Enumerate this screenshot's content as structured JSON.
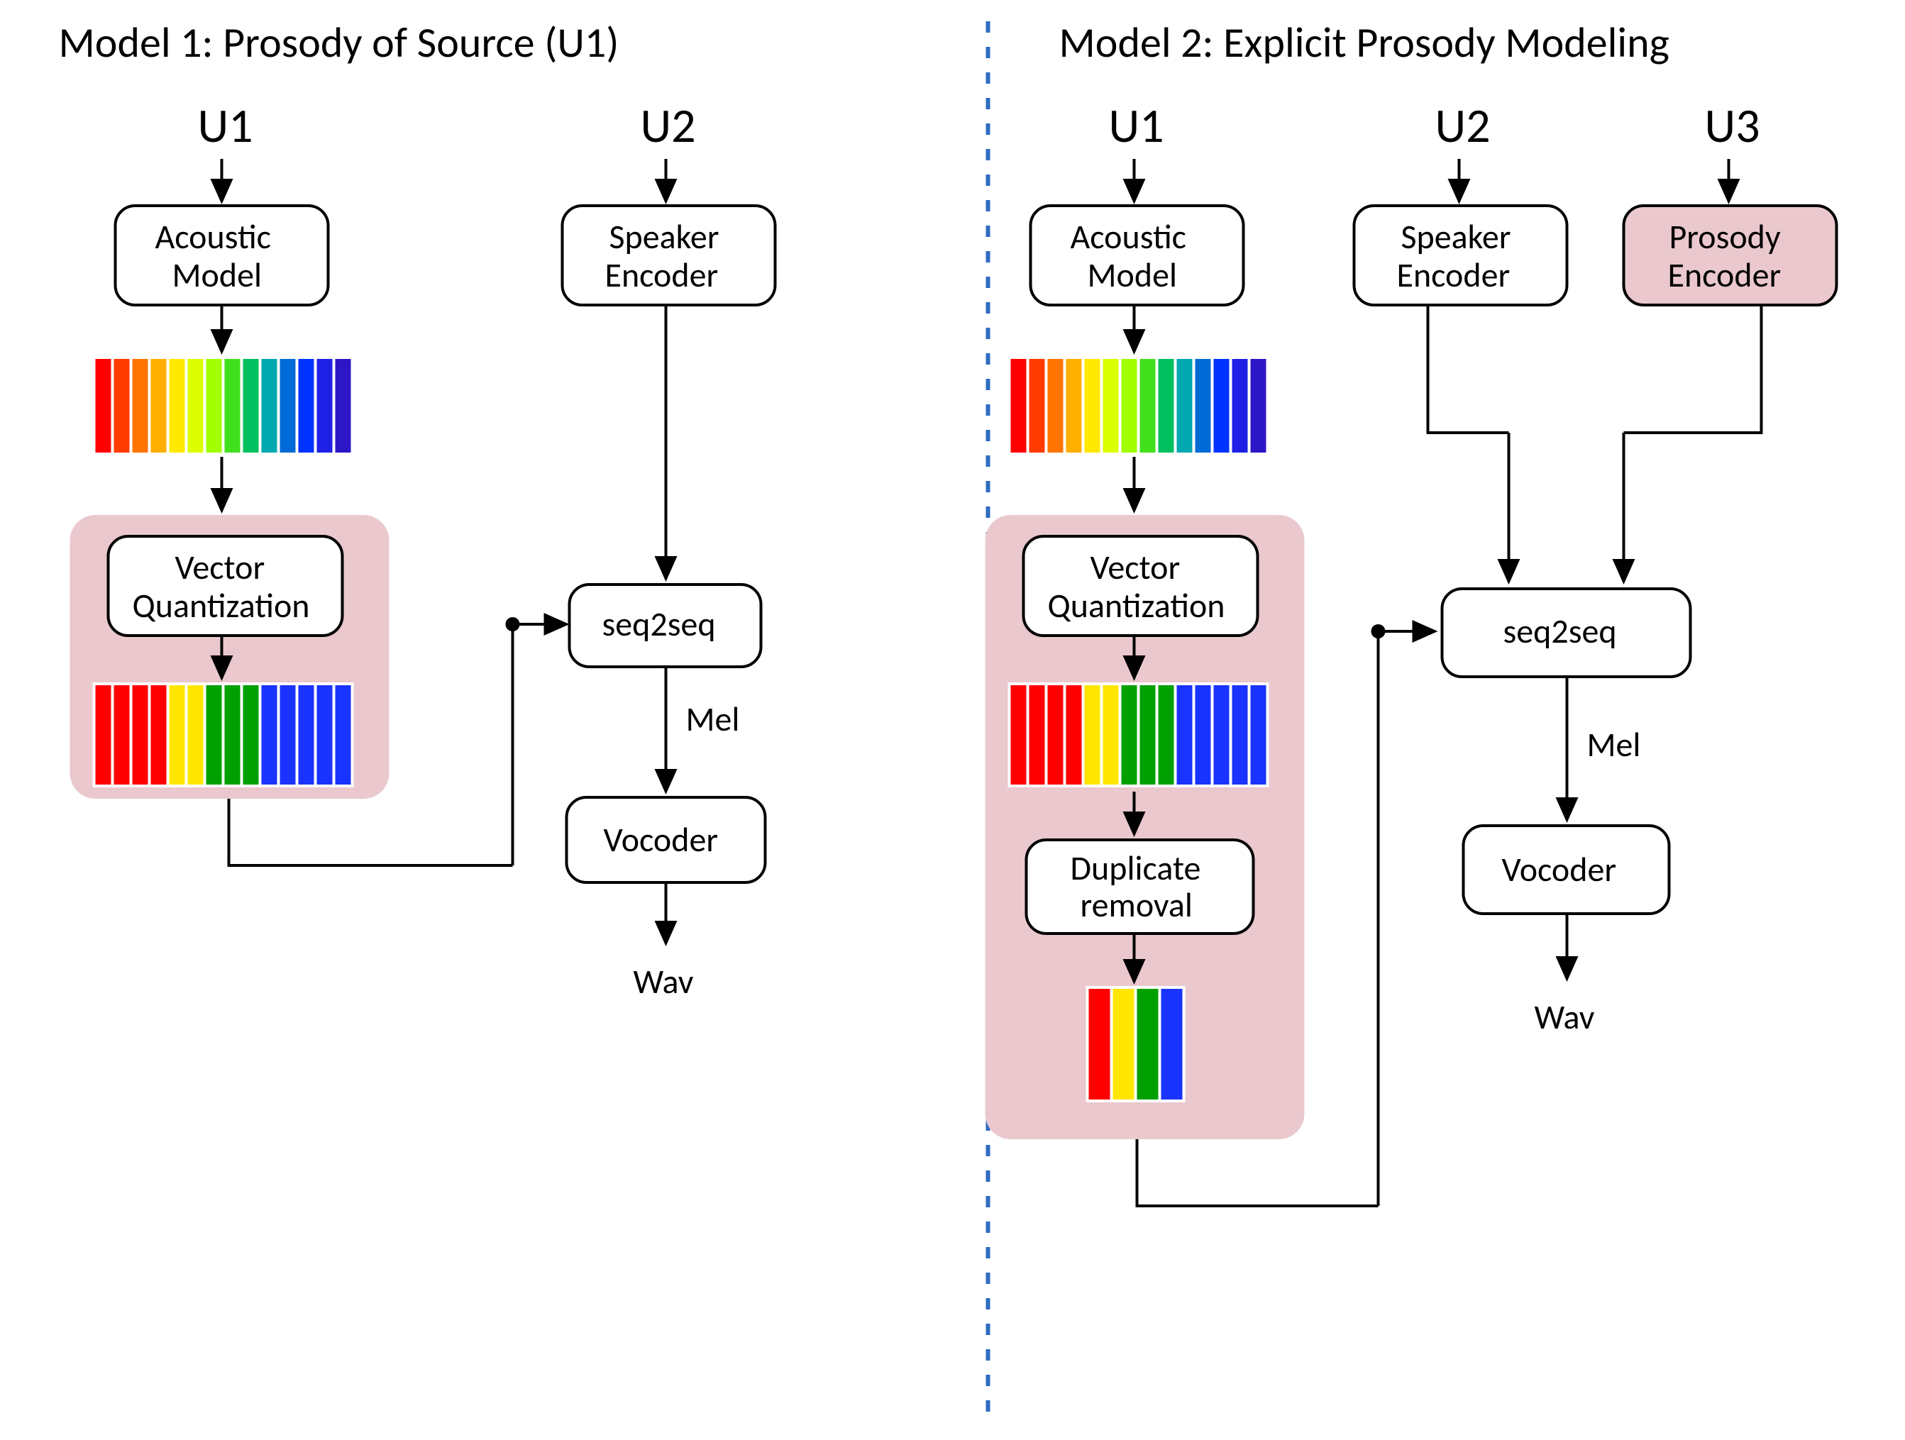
{
  "titles": {
    "left": "Model 1: Prosody of Source (U1)",
    "right": "Model 2: Explicit Prosody Modeling"
  },
  "labels": {
    "U1": "U1",
    "U2": "U2",
    "U3": "U3",
    "acoustic_model": "Acoustic Model",
    "speaker_encoder": "Speaker Encoder",
    "prosody_encoder": "Prosody Encoder",
    "vector_quantization": "Vector Quantization",
    "seq2seq": "seq2seq",
    "mel": "Mel",
    "vocoder": "Vocoder",
    "wav": "Wav",
    "duplicate_removal": "Duplicate removal"
  },
  "palette": {
    "rainbow14": [
      "#ff0000",
      "#ff3b00",
      "#ff7500",
      "#ffaf00",
      "#ffe900",
      "#dbff00",
      "#a1ff00",
      "#41e01c",
      "#00c060",
      "#00a8b0",
      "#006bd6",
      "#0033ff",
      "#1e20e6",
      "#2d16c6"
    ],
    "four": [
      "#ff0000",
      "#ffe600",
      "#00a000",
      "#1a33ff"
    ],
    "fourteenQuant": [
      "#ff0000",
      "#ff0000",
      "#ff0000",
      "#ff0000",
      "#ffe600",
      "#ffe600",
      "#00a000",
      "#00a000",
      "#00a000",
      "#1a33ff",
      "#1a33ff",
      "#1a33ff",
      "#1a33ff",
      "#1a33ff"
    ]
  }
}
